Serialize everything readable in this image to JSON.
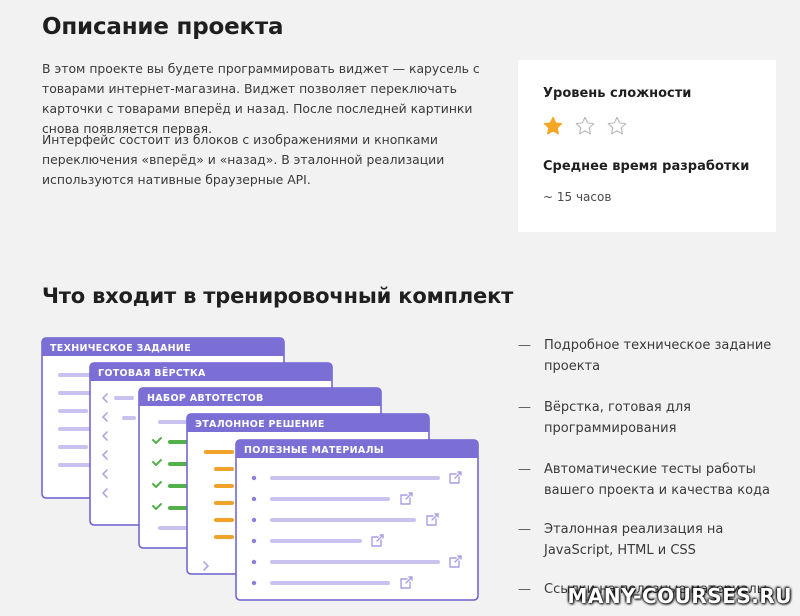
{
  "description": {
    "title": "Описание проекта",
    "paragraphs": [
      "В этом проекте вы будете программировать виджет — карусель с товарами интернет-магазина. Виджет позволяет переключать карточки с товарами вперёд и назад. После последней картинки снова появляется первая.",
      "Интерфейс состоит из блоков с изображениями и кнопками переключения «вперёд» и «назад». В эталонной реализации используются нативные браузерные API."
    ]
  },
  "info_card": {
    "difficulty_label": "Уровень сложности",
    "difficulty_rating": 1,
    "difficulty_max": 5,
    "time_label": "Среднее время разработки",
    "time_value": "~ 15 часов"
  },
  "kit": {
    "title": "Что входит в тренировочный комплект",
    "windows": [
      "ТЕХНИЧЕСКОЕ ЗАДАНИЕ",
      "ГОТОВАЯ ВЁРСТКА",
      "НАБОР АВТОТЕСТОВ",
      "ЭТАЛОННОЕ РЕШЕНИЕ",
      "ПОЛЕЗНЫЕ МАТЕРИАЛЫ"
    ],
    "items": [
      "Подробное техническое задание проекта",
      "Вёрстка, готовая для программирования",
      "Автоматические тесты работы вашего проекта и качества кода",
      "Эталонная реализация на JavaScript, HTML и CSS",
      "Ссылки на полезные материалы"
    ],
    "dash": "—"
  },
  "watermark": "MANY-COURSES.RU",
  "colors": {
    "accent": "#7b6fd6",
    "star_filled": "#f5a623",
    "code_green": "#52b14b",
    "code_orange": "#f0a22a",
    "line_purple": "#c9c2f0"
  },
  "icons": [
    "star-filled-icon",
    "star-empty-icon",
    "external-link-icon",
    "checkmark-icon",
    "chevron-icon"
  ]
}
